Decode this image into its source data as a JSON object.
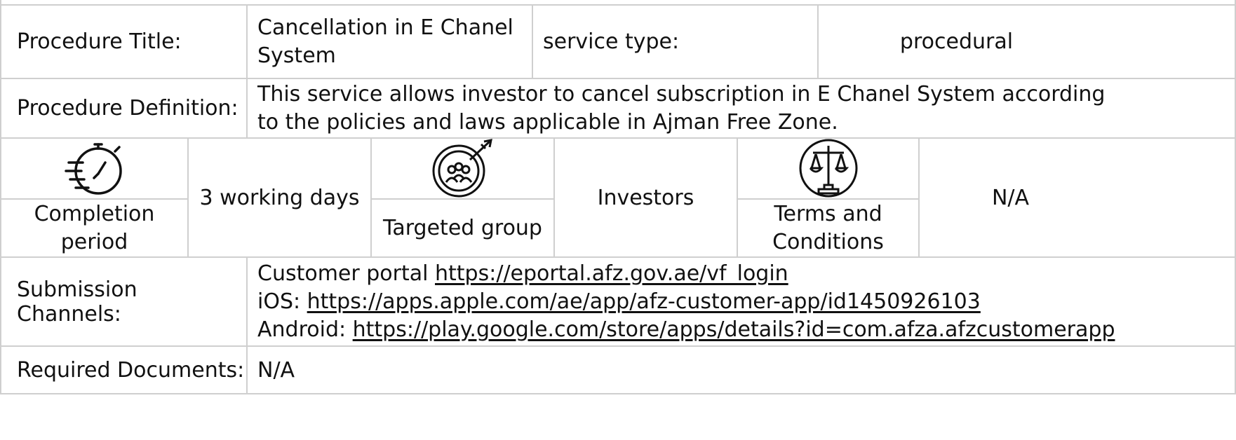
{
  "procedure_title": {
    "label": "Procedure Title:",
    "value": "Cancellation in E Chanel System",
    "service_type_label": "service type:",
    "service_type_value": "procedural"
  },
  "procedure_definition": {
    "label": "Procedure Definition:",
    "value": "This service allows investor to cancel subscription in E Chanel System according to the policies and laws applicable in Ajman Free Zone."
  },
  "info_row": {
    "completion": {
      "icon": "stopwatch-icon",
      "label": "Completion period",
      "value": "3 working days"
    },
    "targeted": {
      "icon": "target-group-icon",
      "label": "Targeted group",
      "value": "Investors"
    },
    "terms": {
      "icon": "scales-of-justice-icon",
      "label": "Terms and Conditions",
      "value": "N/A"
    }
  },
  "submission_channels": {
    "label": "Submission Channels:",
    "portal_prefix": "Customer portal ",
    "portal_url": "https://eportal.afz.gov.ae/vf_login",
    "ios_prefix": "iOS: ",
    "ios_url": "https://apps.apple.com/ae/app/afz-customer-app/id1450926103",
    "android_prefix": "Android: ",
    "android_url": "https://play.google.com/store/apps/details?id=com.afza.afzcustomerapp"
  },
  "required_documents": {
    "label": "Required Documents:",
    "value": "N/A"
  }
}
